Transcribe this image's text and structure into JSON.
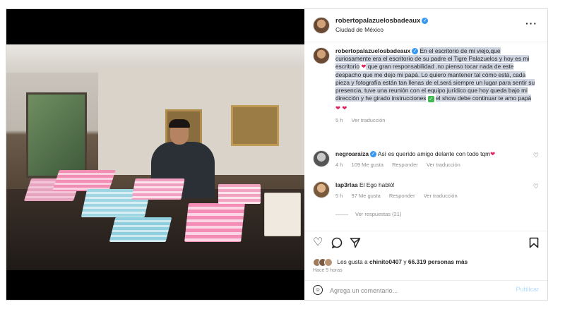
{
  "post": {
    "username": "robertopalazuelosbadeaux",
    "location": "Ciudad de México",
    "more_label": "···"
  },
  "caption": {
    "username": "robertopalazuelosbadeaux",
    "text_part1": "En el escritorio de mi viejo,que curiosamente era el escritorio de su padre el Tigre Palazuelos y hoy es mi escritorio",
    "heart1": "❤",
    "text_part2": " que gran responsabilidad .no pienso tocar nada de este despacho que me dejo mi papá. Lo quiero mantener tal cómo está, cada pieza y fotografía están tan llenas de el,será siempre un lugar para sentir su presencia, tuve una reunión con el equipo jurídico que hoy queda bajo mi dirección y he girado instrucciones",
    "check": "✓",
    "text_part3": "el show debe continuar te amo papá",
    "hearts_end": "❤ ❤",
    "time": "5 h",
    "translate": "Ver traducción"
  },
  "comments": [
    {
      "username": "negroaraiza",
      "text": "Así es querido amigo delante con todo tqm",
      "heart": "❤",
      "time": "4 h",
      "likes": "109 Me gusta",
      "reply": "Responder",
      "translate": "Ver traducción"
    },
    {
      "username": "lap3rlaa",
      "text": "El Ego habló!",
      "time": "5 h",
      "likes": "97 Me gusta",
      "reply": "Responder",
      "translate": "Ver traducción"
    }
  ],
  "view_replies": "Ver respuestas (21)",
  "actions": {
    "liked_by_prefix": "Les gusta a",
    "liked_by_user": "chinito0407",
    "liked_by_and": "y",
    "liked_by_count": "66.319 personas más",
    "time_ago": "Hace 5 horas"
  },
  "add_comment": {
    "placeholder": "Agrega un comentario...",
    "publish_label": "Publicar"
  },
  "colors": {
    "verified": "#3897f0",
    "heart": "#e0245e",
    "highlight": "#cfd6e2",
    "publish_disabled": "#b3dbff"
  }
}
